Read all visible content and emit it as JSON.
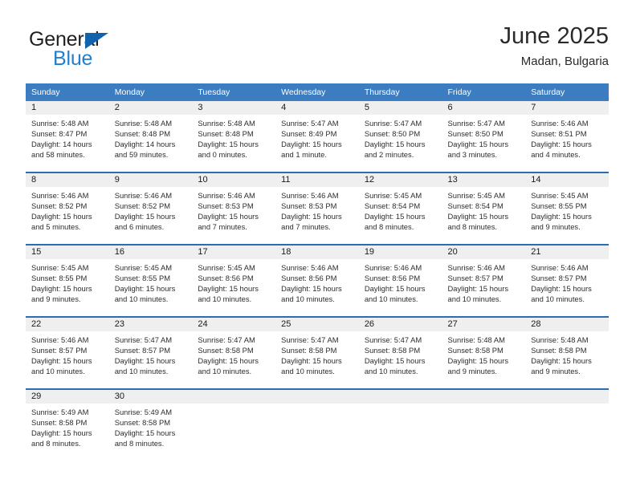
{
  "brand": {
    "line1": "General",
    "line2": "Blue",
    "triangle_color": "#1263ad",
    "line2_color": "#1f7fd1"
  },
  "header": {
    "title": "June 2025",
    "subtitle": "Madan, Bulgaria"
  },
  "theme": {
    "header_row_bg": "#3c7cc0",
    "row_divider": "#2c6cb0",
    "daynum_band_bg": "#efefef"
  },
  "weekday_headers": [
    "Sunday",
    "Monday",
    "Tuesday",
    "Wednesday",
    "Thursday",
    "Friday",
    "Saturday"
  ],
  "weeks": [
    [
      {
        "day": "1",
        "sunrise": "Sunrise: 5:48 AM",
        "sunset": "Sunset: 8:47 PM",
        "daylight1": "Daylight: 14 hours",
        "daylight2": "and 58 minutes."
      },
      {
        "day": "2",
        "sunrise": "Sunrise: 5:48 AM",
        "sunset": "Sunset: 8:48 PM",
        "daylight1": "Daylight: 14 hours",
        "daylight2": "and 59 minutes."
      },
      {
        "day": "3",
        "sunrise": "Sunrise: 5:48 AM",
        "sunset": "Sunset: 8:48 PM",
        "daylight1": "Daylight: 15 hours",
        "daylight2": "and 0 minutes."
      },
      {
        "day": "4",
        "sunrise": "Sunrise: 5:47 AM",
        "sunset": "Sunset: 8:49 PM",
        "daylight1": "Daylight: 15 hours",
        "daylight2": "and 1 minute."
      },
      {
        "day": "5",
        "sunrise": "Sunrise: 5:47 AM",
        "sunset": "Sunset: 8:50 PM",
        "daylight1": "Daylight: 15 hours",
        "daylight2": "and 2 minutes."
      },
      {
        "day": "6",
        "sunrise": "Sunrise: 5:47 AM",
        "sunset": "Sunset: 8:50 PM",
        "daylight1": "Daylight: 15 hours",
        "daylight2": "and 3 minutes."
      },
      {
        "day": "7",
        "sunrise": "Sunrise: 5:46 AM",
        "sunset": "Sunset: 8:51 PM",
        "daylight1": "Daylight: 15 hours",
        "daylight2": "and 4 minutes."
      }
    ],
    [
      {
        "day": "8",
        "sunrise": "Sunrise: 5:46 AM",
        "sunset": "Sunset: 8:52 PM",
        "daylight1": "Daylight: 15 hours",
        "daylight2": "and 5 minutes."
      },
      {
        "day": "9",
        "sunrise": "Sunrise: 5:46 AM",
        "sunset": "Sunset: 8:52 PM",
        "daylight1": "Daylight: 15 hours",
        "daylight2": "and 6 minutes."
      },
      {
        "day": "10",
        "sunrise": "Sunrise: 5:46 AM",
        "sunset": "Sunset: 8:53 PM",
        "daylight1": "Daylight: 15 hours",
        "daylight2": "and 7 minutes."
      },
      {
        "day": "11",
        "sunrise": "Sunrise: 5:46 AM",
        "sunset": "Sunset: 8:53 PM",
        "daylight1": "Daylight: 15 hours",
        "daylight2": "and 7 minutes."
      },
      {
        "day": "12",
        "sunrise": "Sunrise: 5:45 AM",
        "sunset": "Sunset: 8:54 PM",
        "daylight1": "Daylight: 15 hours",
        "daylight2": "and 8 minutes."
      },
      {
        "day": "13",
        "sunrise": "Sunrise: 5:45 AM",
        "sunset": "Sunset: 8:54 PM",
        "daylight1": "Daylight: 15 hours",
        "daylight2": "and 8 minutes."
      },
      {
        "day": "14",
        "sunrise": "Sunrise: 5:45 AM",
        "sunset": "Sunset: 8:55 PM",
        "daylight1": "Daylight: 15 hours",
        "daylight2": "and 9 minutes."
      }
    ],
    [
      {
        "day": "15",
        "sunrise": "Sunrise: 5:45 AM",
        "sunset": "Sunset: 8:55 PM",
        "daylight1": "Daylight: 15 hours",
        "daylight2": "and 9 minutes."
      },
      {
        "day": "16",
        "sunrise": "Sunrise: 5:45 AM",
        "sunset": "Sunset: 8:55 PM",
        "daylight1": "Daylight: 15 hours",
        "daylight2": "and 10 minutes."
      },
      {
        "day": "17",
        "sunrise": "Sunrise: 5:45 AM",
        "sunset": "Sunset: 8:56 PM",
        "daylight1": "Daylight: 15 hours",
        "daylight2": "and 10 minutes."
      },
      {
        "day": "18",
        "sunrise": "Sunrise: 5:46 AM",
        "sunset": "Sunset: 8:56 PM",
        "daylight1": "Daylight: 15 hours",
        "daylight2": "and 10 minutes."
      },
      {
        "day": "19",
        "sunrise": "Sunrise: 5:46 AM",
        "sunset": "Sunset: 8:56 PM",
        "daylight1": "Daylight: 15 hours",
        "daylight2": "and 10 minutes."
      },
      {
        "day": "20",
        "sunrise": "Sunrise: 5:46 AM",
        "sunset": "Sunset: 8:57 PM",
        "daylight1": "Daylight: 15 hours",
        "daylight2": "and 10 minutes."
      },
      {
        "day": "21",
        "sunrise": "Sunrise: 5:46 AM",
        "sunset": "Sunset: 8:57 PM",
        "daylight1": "Daylight: 15 hours",
        "daylight2": "and 10 minutes."
      }
    ],
    [
      {
        "day": "22",
        "sunrise": "Sunrise: 5:46 AM",
        "sunset": "Sunset: 8:57 PM",
        "daylight1": "Daylight: 15 hours",
        "daylight2": "and 10 minutes."
      },
      {
        "day": "23",
        "sunrise": "Sunrise: 5:47 AM",
        "sunset": "Sunset: 8:57 PM",
        "daylight1": "Daylight: 15 hours",
        "daylight2": "and 10 minutes."
      },
      {
        "day": "24",
        "sunrise": "Sunrise: 5:47 AM",
        "sunset": "Sunset: 8:58 PM",
        "daylight1": "Daylight: 15 hours",
        "daylight2": "and 10 minutes."
      },
      {
        "day": "25",
        "sunrise": "Sunrise: 5:47 AM",
        "sunset": "Sunset: 8:58 PM",
        "daylight1": "Daylight: 15 hours",
        "daylight2": "and 10 minutes."
      },
      {
        "day": "26",
        "sunrise": "Sunrise: 5:47 AM",
        "sunset": "Sunset: 8:58 PM",
        "daylight1": "Daylight: 15 hours",
        "daylight2": "and 10 minutes."
      },
      {
        "day": "27",
        "sunrise": "Sunrise: 5:48 AM",
        "sunset": "Sunset: 8:58 PM",
        "daylight1": "Daylight: 15 hours",
        "daylight2": "and 9 minutes."
      },
      {
        "day": "28",
        "sunrise": "Sunrise: 5:48 AM",
        "sunset": "Sunset: 8:58 PM",
        "daylight1": "Daylight: 15 hours",
        "daylight2": "and 9 minutes."
      }
    ],
    [
      {
        "day": "29",
        "sunrise": "Sunrise: 5:49 AM",
        "sunset": "Sunset: 8:58 PM",
        "daylight1": "Daylight: 15 hours",
        "daylight2": "and 8 minutes."
      },
      {
        "day": "30",
        "sunrise": "Sunrise: 5:49 AM",
        "sunset": "Sunset: 8:58 PM",
        "daylight1": "Daylight: 15 hours",
        "daylight2": "and 8 minutes."
      },
      {
        "day": "",
        "sunrise": "",
        "sunset": "",
        "daylight1": "",
        "daylight2": ""
      },
      {
        "day": "",
        "sunrise": "",
        "sunset": "",
        "daylight1": "",
        "daylight2": ""
      },
      {
        "day": "",
        "sunrise": "",
        "sunset": "",
        "daylight1": "",
        "daylight2": ""
      },
      {
        "day": "",
        "sunrise": "",
        "sunset": "",
        "daylight1": "",
        "daylight2": ""
      },
      {
        "day": "",
        "sunrise": "",
        "sunset": "",
        "daylight1": "",
        "daylight2": ""
      }
    ]
  ]
}
